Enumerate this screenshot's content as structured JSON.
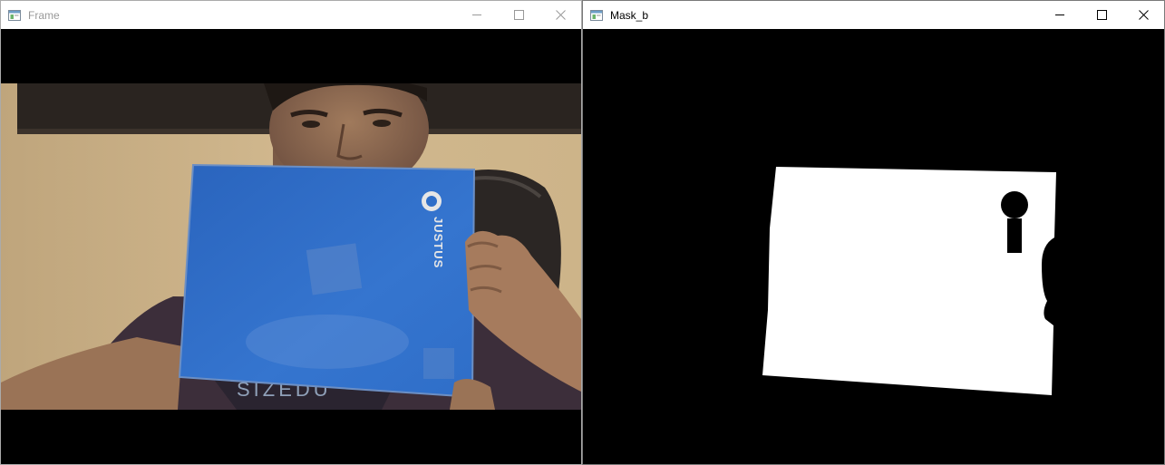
{
  "windows": {
    "frame": {
      "title": "Frame",
      "icon": "window-icon",
      "controls": [
        "minimize",
        "maximize",
        "close"
      ]
    },
    "mask": {
      "title": "Mask_b",
      "icon": "window-icon",
      "controls": [
        "minimize",
        "maximize",
        "close"
      ]
    }
  },
  "camera_image": {
    "notebook_brand": "JUSTUS",
    "notebook_color": "#2f6ec8"
  },
  "mask_image": {
    "foreground_color": "#ffffff",
    "background_color": "#000000"
  }
}
